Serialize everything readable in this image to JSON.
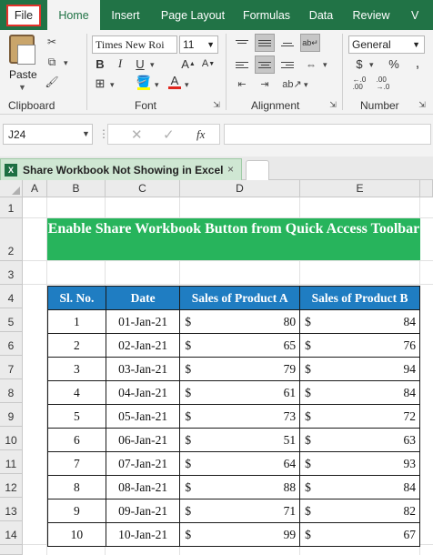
{
  "ribbon": {
    "tabs": [
      "File",
      "Home",
      "Insert",
      "Page Layout",
      "Formulas",
      "Data",
      "Review",
      "V"
    ],
    "clipboard": {
      "paste_label": "Paste",
      "group_label": "Clipboard"
    },
    "font": {
      "name": "Times New Roi",
      "size": "11",
      "group_label": "Font"
    },
    "alignment": {
      "group_label": "Alignment"
    },
    "number": {
      "format": "General",
      "group_label": "Number"
    }
  },
  "formula_bar": {
    "name_box": "J24",
    "fx": "fx",
    "formula": ""
  },
  "workbook": {
    "tab_title": "Share Workbook Not Showing in Excel",
    "close_glyph": "×"
  },
  "grid": {
    "columns": [
      "A",
      "B",
      "C",
      "D",
      "E"
    ],
    "rows": [
      "1",
      "2",
      "3",
      "4",
      "5",
      "6",
      "7",
      "8",
      "9",
      "10",
      "11",
      "12",
      "13",
      "14"
    ]
  },
  "sheet": {
    "title": "Enable Share Workbook Button from Quick Access Toolbar",
    "headers": [
      "Sl. No.",
      "Date",
      "Sales of Product A",
      "Sales of Product B"
    ],
    "currency": "$",
    "rows": [
      {
        "sl": "1",
        "date": "01-Jan-21",
        "a": "80",
        "b": "84"
      },
      {
        "sl": "2",
        "date": "02-Jan-21",
        "a": "65",
        "b": "76"
      },
      {
        "sl": "3",
        "date": "03-Jan-21",
        "a": "79",
        "b": "94"
      },
      {
        "sl": "4",
        "date": "04-Jan-21",
        "a": "61",
        "b": "84"
      },
      {
        "sl": "5",
        "date": "05-Jan-21",
        "a": "73",
        "b": "72"
      },
      {
        "sl": "6",
        "date": "06-Jan-21",
        "a": "51",
        "b": "63"
      },
      {
        "sl": "7",
        "date": "07-Jan-21",
        "a": "64",
        "b": "93"
      },
      {
        "sl": "8",
        "date": "08-Jan-21",
        "a": "88",
        "b": "84"
      },
      {
        "sl": "9",
        "date": "09-Jan-21",
        "a": "71",
        "b": "82"
      },
      {
        "sl": "10",
        "date": "10-Jan-21",
        "a": "99",
        "b": "67"
      }
    ]
  },
  "colors": {
    "ribbon_green": "#217346",
    "banner_green": "#27b45c",
    "header_blue": "#1f7dc2",
    "file_highlight": "#e5322b"
  }
}
